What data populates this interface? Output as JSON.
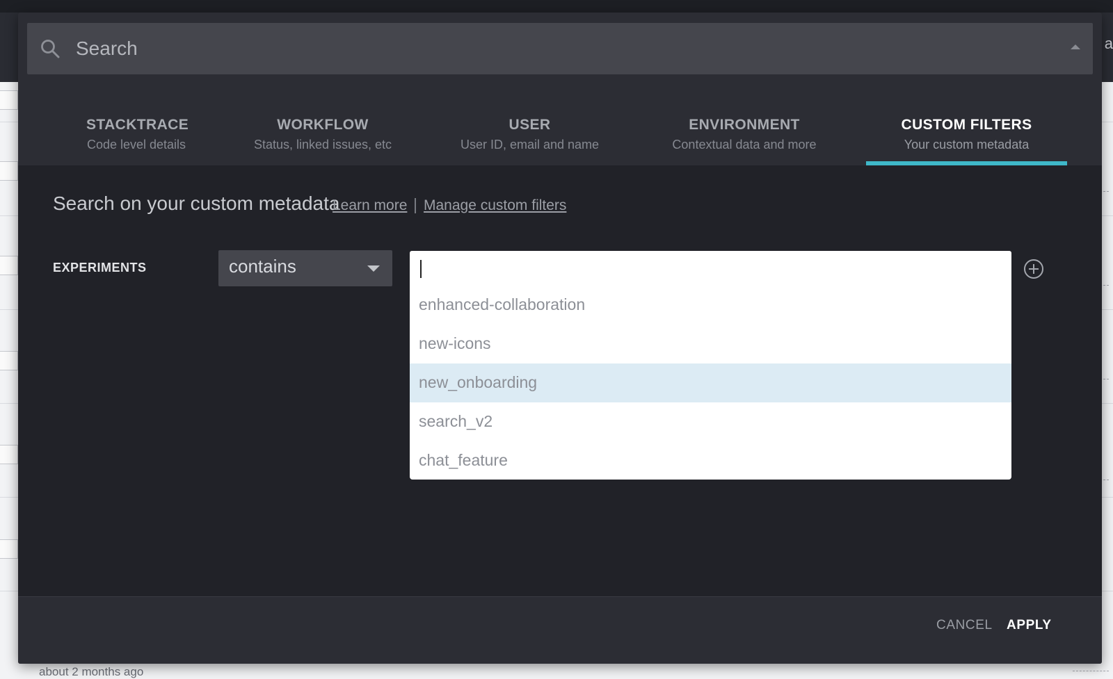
{
  "search": {
    "placeholder": "Search"
  },
  "tabs": [
    {
      "title": "STACKTRACE",
      "subtitle": "Code level details"
    },
    {
      "title": "WORKFLOW",
      "subtitle": "Status, linked issues, etc"
    },
    {
      "title": "USER",
      "subtitle": "User ID, email and name"
    },
    {
      "title": "ENVIRONMENT",
      "subtitle": "Contextual data and more"
    },
    {
      "title": "CUSTOM FILTERS",
      "subtitle": "Your custom metadata"
    }
  ],
  "active_tab": "CUSTOM FILTERS",
  "section": {
    "title": "Search on your custom metadata",
    "learn_more": "Learn more",
    "separator": "|",
    "manage": "Manage custom filters"
  },
  "filter": {
    "label": "EXPERIMENTS",
    "operator": "contains",
    "value": "",
    "options": [
      "enhanced-collaboration",
      "new-icons",
      "new_onboarding",
      "search_v2",
      "chat_feature"
    ],
    "highlighted_option": "new_onboarding"
  },
  "footer": {
    "cancel": "CANCEL",
    "apply": "APPLY"
  },
  "background": {
    "right_letter": "a",
    "bottom_text": "about 2 months ago"
  },
  "colors": {
    "accent": "#3fb8c9",
    "highlight": "#dcebf4",
    "modal_bg": "#212228"
  }
}
